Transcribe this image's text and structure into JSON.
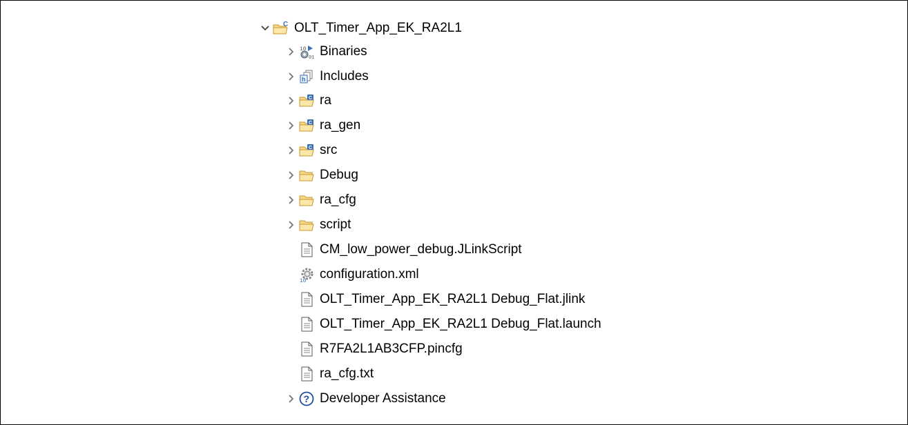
{
  "project_tree": {
    "root": {
      "label": "OLT_Timer_App_EK_RA2L1",
      "expanded": true,
      "icon": "c-project-folder-icon"
    },
    "items": [
      {
        "label": "Binaries",
        "icon": "binaries-icon",
        "expandable": true
      },
      {
        "label": "Includes",
        "icon": "includes-icon",
        "expandable": true
      },
      {
        "label": "ra",
        "icon": "source-folder-icon",
        "expandable": true
      },
      {
        "label": "ra_gen",
        "icon": "source-folder-icon",
        "expandable": true
      },
      {
        "label": "src",
        "icon": "source-folder-icon",
        "expandable": true
      },
      {
        "label": "Debug",
        "icon": "folder-icon",
        "expandable": true
      },
      {
        "label": "ra_cfg",
        "icon": "folder-icon",
        "expandable": true
      },
      {
        "label": "script",
        "icon": "folder-icon",
        "expandable": true
      },
      {
        "label": "CM_low_power_debug.JLinkScript",
        "icon": "file-icon",
        "expandable": false
      },
      {
        "label": "configuration.xml",
        "icon": "configuration-gear-icon",
        "expandable": false
      },
      {
        "label": "OLT_Timer_App_EK_RA2L1 Debug_Flat.jlink",
        "icon": "file-icon",
        "expandable": false
      },
      {
        "label": "OLT_Timer_App_EK_RA2L1 Debug_Flat.launch",
        "icon": "file-icon",
        "expandable": false
      },
      {
        "label": "R7FA2L1AB3CFP.pincfg",
        "icon": "file-icon",
        "expandable": false
      },
      {
        "label": "ra_cfg.txt",
        "icon": "file-icon",
        "expandable": false
      },
      {
        "label": "Developer Assistance",
        "icon": "help-icon",
        "expandable": true
      }
    ]
  },
  "colors": {
    "folder_fill": "#f5d88e",
    "folder_stroke": "#c9962b",
    "source_badge": "#3b6fb6",
    "arrow": "#6e6e6e",
    "help_blue": "#1f4e9c"
  }
}
